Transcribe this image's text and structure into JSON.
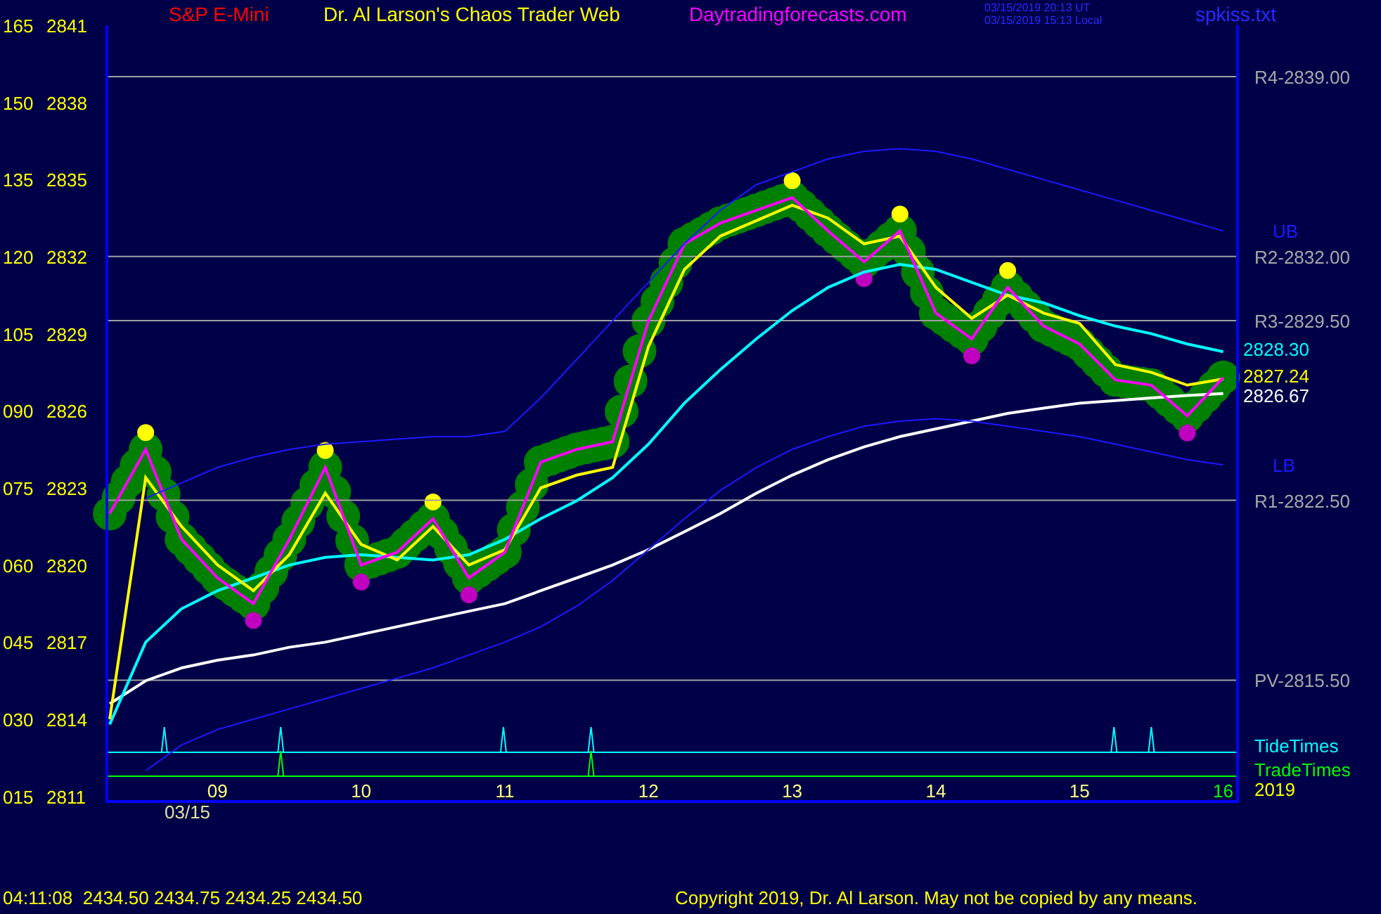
{
  "header": {
    "symbol": "S&P E-Mini",
    "title": "Dr. Al Larson's Chaos Trader Web",
    "website": "Daytradingforecasts.com",
    "timestamp_ut": "03/15/2019 20:13 UT",
    "timestamp_local": "03/15/2019 15:13 Local",
    "file": "spkiss.txt"
  },
  "chart": {
    "chart_data": {
      "type": "line",
      "x": [
        8.25,
        8.5,
        8.75,
        9,
        9.25,
        9.5,
        9.75,
        10,
        10.25,
        10.5,
        10.75,
        11,
        11.25,
        11.5,
        11.75,
        12,
        12.25,
        12.5,
        12.75,
        13,
        13.25,
        13.5,
        13.75,
        14,
        14.25,
        14.5,
        14.75,
        15,
        15.25,
        15.5,
        15.75,
        16
      ],
      "series": [
        {
          "color": "#ffffff",
          "values": [
            2814.6,
            2815.5,
            2816,
            2816.3,
            2816.5,
            2816.8,
            2817,
            2817.3,
            2817.6,
            2817.9,
            2818.2,
            2818.5,
            2819,
            2819.5,
            2820,
            2820.6,
            2821.3,
            2822,
            2822.8,
            2823.5,
            2824.1,
            2824.6,
            2825,
            2825.3,
            2825.6,
            2825.9,
            2826.1,
            2826.3,
            2826.4,
            2826.5,
            2826.6,
            2826.67
          ]
        },
        {
          "color": "#00ffff",
          "values": [
            2813.8,
            2817,
            2818.3,
            2819,
            2819.5,
            2820,
            2820.3,
            2820.4,
            2820.3,
            2820.2,
            2820.4,
            2821,
            2821.8,
            2822.5,
            2823.4,
            2824.7,
            2826.3,
            2827.6,
            2828.8,
            2829.9,
            2830.8,
            2831.4,
            2831.7,
            2831.5,
            2831,
            2830.5,
            2830.2,
            2829.7,
            2829.3,
            2829,
            2828.6,
            2828.3
          ]
        },
        {
          "color": "#ffff00",
          "values": [
            2814,
            2823.4,
            2821.5,
            2820,
            2819,
            2820.4,
            2822.8,
            2820.8,
            2820.2,
            2821.5,
            2820,
            2820.6,
            2823,
            2823.5,
            2823.8,
            2828.5,
            2831.5,
            2832.8,
            2833.4,
            2834,
            2833.5,
            2832.5,
            2832.8,
            2830.8,
            2829.6,
            2830.5,
            2829.8,
            2829.4,
            2827.8,
            2827.5,
            2827,
            2827.24
          ]
        },
        {
          "color": "#ff00ff",
          "values": [
            2822,
            2824.5,
            2821,
            2819.5,
            2818.5,
            2821,
            2823.8,
            2820,
            2820.5,
            2821.8,
            2819.5,
            2820.5,
            2824,
            2824.5,
            2824.8,
            2829.5,
            2832.5,
            2833.3,
            2833.8,
            2834.3,
            2833,
            2831.8,
            2833,
            2829.8,
            2828.8,
            2830.8,
            2829.3,
            2828.6,
            2827.2,
            2827,
            2825.8,
            2827.3
          ]
        },
        {
          "name": "UB",
          "color": "#1a1aff",
          "values": [
            null,
            2822.6,
            2823.2,
            2823.8,
            2824.2,
            2824.5,
            2824.7,
            2824.8,
            2824.9,
            2825,
            2825,
            2825.2,
            2826.5,
            2828,
            2829.5,
            2831,
            2832.5,
            2833.8,
            2834.8,
            2835.3,
            2835.8,
            2836.1,
            2836.2,
            2836.1,
            2835.8,
            2835.4,
            2835,
            2834.6,
            2834.2,
            2833.8,
            2833.4,
            2833
          ]
        },
        {
          "name": "LB",
          "color": "#1a1aff",
          "values": [
            null,
            2812,
            2813,
            2813.6,
            2814,
            2814.4,
            2814.8,
            2815.2,
            2815.6,
            2816,
            2816.5,
            2817,
            2817.6,
            2818.4,
            2819.4,
            2820.6,
            2821.8,
            2822.9,
            2823.8,
            2824.5,
            2825,
            2825.4,
            2825.6,
            2825.7,
            2825.6,
            2825.4,
            2825.2,
            2825,
            2824.7,
            2824.4,
            2824.1,
            2823.9
          ]
        }
      ],
      "xlim": [
        8.23,
        16.1
      ],
      "ylim": [
        2810.8,
        2841
      ],
      "xticks": [
        {
          "value": 9,
          "label": "09"
        },
        {
          "value": 10,
          "label": "10"
        },
        {
          "value": 11,
          "label": "11"
        },
        {
          "value": 12,
          "label": "12"
        },
        {
          "value": 13,
          "label": "13"
        },
        {
          "value": 14,
          "label": "14"
        },
        {
          "value": 15,
          "label": "15"
        },
        {
          "value": 16,
          "label": "16"
        }
      ],
      "yticks": [
        2841,
        2838,
        2835,
        2832,
        2829,
        2826,
        2823,
        2820,
        2817,
        2814,
        2811
      ]
    },
    "level_labels": [
      "R4-2839.00",
      "R2-2832.00",
      "R3-2829.50",
      "R1-2822.50",
      "PV-2815.50"
    ],
    "left_axis_labels": [
      "165",
      "150",
      "135",
      "120",
      "105",
      "090",
      "075",
      "060",
      "045",
      "030",
      "015"
    ],
    "date_label": "03/15",
    "value_labels": [
      {
        "text": "2828.30",
        "color": "#00ffff"
      },
      {
        "text": "2827.24",
        "color": "#ffff00"
      },
      {
        "text": "2826.67",
        "color": "#ffffff"
      }
    ],
    "timing_rows": [
      {
        "label": "TideTimes",
        "color": "#00ffff"
      },
      {
        "label": "TradeTimes",
        "color": "#00ff00"
      }
    ],
    "year_label": "2019"
  },
  "status_bar": {
    "quote": "04:11:08  2434.50 2434.75 2434.25 2434.50",
    "copyright": "Copyright 2019, Dr. Al Larson. May not be copied by any means."
  }
}
